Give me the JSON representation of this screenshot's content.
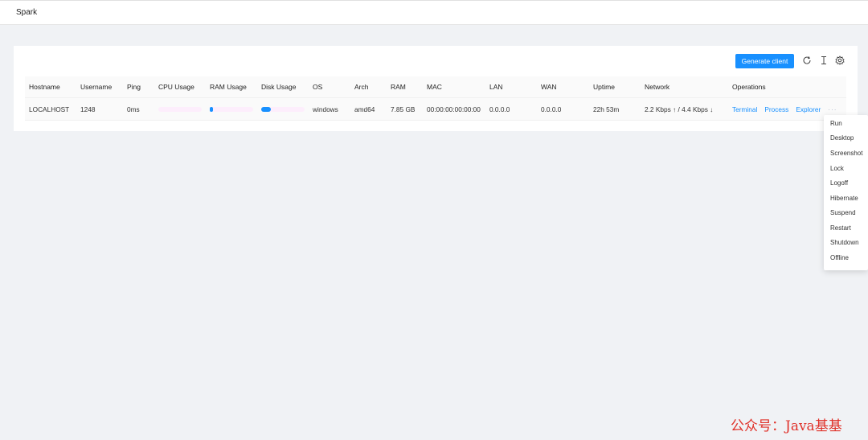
{
  "app": {
    "title": "Spark"
  },
  "toolbar": {
    "generate_label": "Generate client",
    "icons": [
      "refresh-icon",
      "text-cursor-icon",
      "settings-icon"
    ]
  },
  "table": {
    "columns": [
      "Hostname",
      "Username",
      "Ping",
      "CPU Usage",
      "RAM Usage",
      "Disk Usage",
      "OS",
      "Arch",
      "RAM",
      "MAC",
      "LAN",
      "WAN",
      "Uptime",
      "Network",
      "Operations"
    ],
    "rows": [
      {
        "hostname": "LOCALHOST",
        "username": "1248",
        "ping": "0ms",
        "cpu_usage_fraction": 0.0,
        "ram_usage_fraction": 0.06,
        "disk_usage_fraction": 0.22,
        "os": "windows",
        "arch": "amd64",
        "ram": "7.85 GB",
        "mac": "00:00:00:00:00:00",
        "lan": "0.0.0.0",
        "wan": "0.0.0.0",
        "uptime": "22h 53m",
        "network": "2.2 Kbps ↑ / 4.4 Kbps ↓",
        "operations": [
          "Terminal",
          "Process",
          "Explorer"
        ],
        "more": "···"
      }
    ]
  },
  "bar_colors": {
    "track": "#fdeefc",
    "fill": "#1890ff"
  },
  "dropdown_menu": {
    "items": [
      "Run",
      "Desktop",
      "Screenshot",
      "Lock",
      "Logoff",
      "Hibernate",
      "Suspend",
      "Restart",
      "Shutdown",
      "Offline"
    ]
  },
  "watermark": "公众号：Java基基",
  "colors": {
    "accent": "#1890ff",
    "background": "#f0f2f5",
    "watermark": "#e0322a"
  }
}
